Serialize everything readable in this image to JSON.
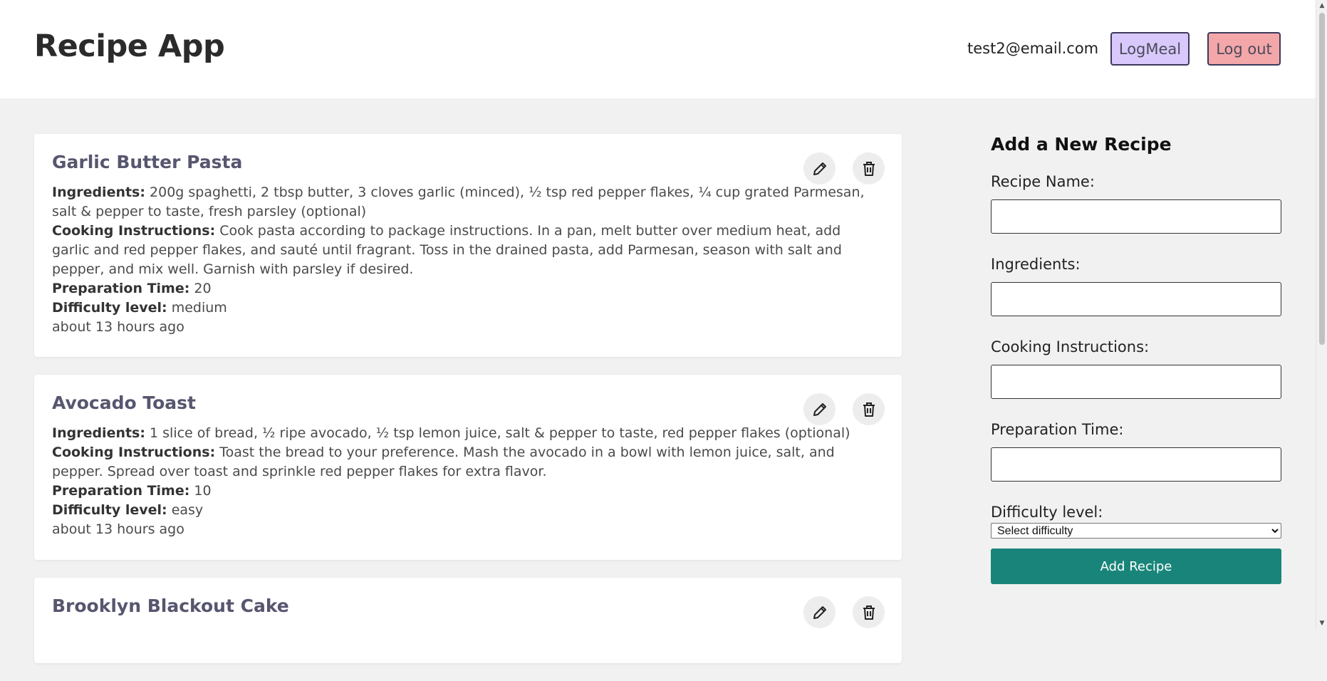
{
  "header": {
    "title": "Recipe App",
    "user_email": "test2@email.com",
    "logmeal_label": "LogMeal",
    "logout_label": "Log out"
  },
  "colors": {
    "logmeal_bg": "#d8c8fb",
    "logout_bg": "#f3a7a9",
    "add_button_bg": "#19857a",
    "recipe_title": "#57566f"
  },
  "icons": {
    "edit": "pencil-icon",
    "delete": "trash-icon"
  },
  "recipes": [
    {
      "title": "Garlic Butter Pasta",
      "ingredients_label": "Ingredients:",
      "ingredients": "200g spaghetti, 2 tbsp butter, 3 cloves garlic (minced), ½ tsp red pepper flakes, ¼ cup grated Parmesan, salt & pepper to taste, fresh parsley (optional)",
      "instructions_label": "Cooking Instructions:",
      "instructions": "Cook pasta according to package instructions. In a pan, melt butter over medium heat, add garlic and red pepper flakes, and sauté until fragrant. Toss in the drained pasta, add Parmesan, season with salt and pepper, and mix well. Garnish with parsley if desired.",
      "prep_label": "Preparation Time:",
      "prep_time": "20",
      "difficulty_label": "Difficulty level:",
      "difficulty": "medium",
      "timestamp": "about 13 hours ago"
    },
    {
      "title": "Avocado Toast",
      "ingredients_label": "Ingredients:",
      "ingredients": "1 slice of bread, ½ ripe avocado, ½ tsp lemon juice, salt & pepper to taste, red pepper flakes (optional)",
      "instructions_label": "Cooking Instructions:",
      "instructions": "Toast the bread to your preference. Mash the avocado in a bowl with lemon juice, salt, and pepper. Spread over toast and sprinkle red pepper flakes for extra flavor.",
      "prep_label": "Preparation Time:",
      "prep_time": "10",
      "difficulty_label": "Difficulty level:",
      "difficulty": "easy",
      "timestamp": "about 13 hours ago"
    },
    {
      "title": "Brooklyn Blackout Cake"
    }
  ],
  "form": {
    "title": "Add a New Recipe",
    "name_label": "Recipe Name:",
    "name_value": "",
    "ingredients_label": "Ingredients:",
    "ingredients_value": "",
    "instructions_label": "Cooking Instructions:",
    "instructions_value": "",
    "prep_label": "Preparation Time:",
    "prep_value": "",
    "difficulty_label": "Difficulty level:",
    "difficulty_selected": "Select difficulty",
    "submit_label": "Add Recipe"
  },
  "scrollbar": {
    "thumb_fraction": 0.55
  }
}
